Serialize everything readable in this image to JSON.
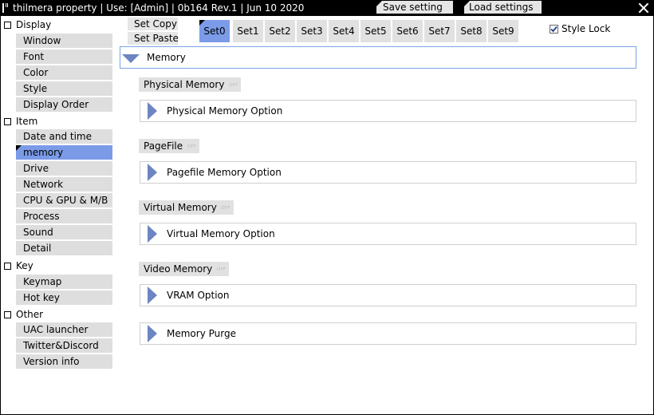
{
  "titlebar": {
    "title": "thilmera property | Use: [Admin] | 0b164 Rev.1 | Jun 10 2020",
    "save_label": "Save setting",
    "load_label": "Load settings"
  },
  "sidebar": {
    "categories": [
      {
        "label": "Display",
        "items": [
          "Window",
          "Font",
          "Color",
          "Style",
          "Display Order"
        ]
      },
      {
        "label": "Item",
        "items": [
          "Date and time",
          "memory",
          "Drive",
          "Network",
          "CPU & GPU & M/B",
          "Process",
          "Sound",
          "Detail"
        ]
      },
      {
        "label": "Key",
        "items": [
          "Keymap",
          "Hot key"
        ]
      },
      {
        "label": "Other",
        "items": [
          "UAC launcher",
          "Twitter&Discord",
          "Version info"
        ]
      }
    ],
    "active_item": "memory"
  },
  "toolbar": {
    "set_copy": "Set Copy",
    "set_paste": "Set Paste",
    "tabs": [
      "Set0",
      "Set1",
      "Set2",
      "Set3",
      "Set4",
      "Set5",
      "Set6",
      "Set7",
      "Set8",
      "Set9"
    ],
    "active_tab": "Set0",
    "style_lock_label": "Style Lock",
    "style_lock_checked": true
  },
  "main": {
    "section_title": "Memory",
    "groups": [
      {
        "heading": "Physical Memory",
        "heading_badge": "OFF",
        "option": "Physical Memory Option"
      },
      {
        "heading": "PageFile",
        "heading_badge": "OFF",
        "option": "Pagefile Memory Option"
      },
      {
        "heading": "Virtual Memory",
        "heading_badge": "OFF",
        "option": "Virtual Memory Option"
      },
      {
        "heading": "Video Memory",
        "heading_badge": "OFF",
        "option": "VRAM Option"
      }
    ],
    "purge_label": "Memory Purge"
  },
  "colors": {
    "accent_blue": "#7b9be8",
    "triangle_blue": "#6d85c2",
    "button_gray": "#e1e1e1",
    "titlebar": "#000000"
  }
}
